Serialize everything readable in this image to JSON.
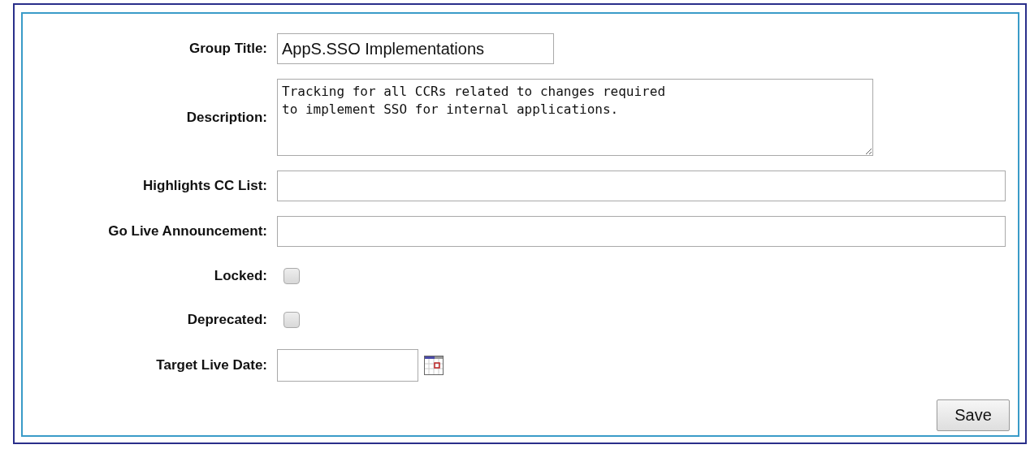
{
  "fields": [
    {
      "kind": "text",
      "label": "Group Title:",
      "value": "AppS.SSO Implementations"
    },
    {
      "kind": "textarea",
      "label": "Description:",
      "value": "Tracking for all CCRs related to changes required\nto implement SSO for internal applications."
    },
    {
      "kind": "wide",
      "label": "Highlights CC List:"
    },
    {
      "kind": "wide",
      "label": "Go Live Announcement:"
    },
    {
      "kind": "checkbox",
      "label": "Locked:",
      "checked": false
    },
    {
      "kind": "checkbox",
      "label": "Deprecated:",
      "checked": false
    },
    {
      "kind": "date",
      "label": "Target Live Date:"
    }
  ],
  "save_button": "Save"
}
